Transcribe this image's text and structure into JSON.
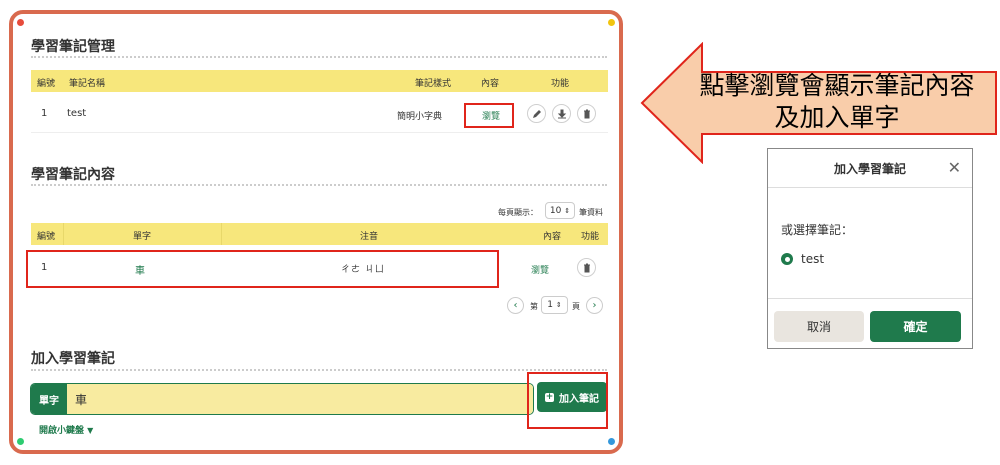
{
  "manage": {
    "title": "學習筆記管理",
    "headers": {
      "no": "編號",
      "name": "筆記名稱",
      "style": "筆記樣式",
      "content": "內容",
      "func": "功能"
    },
    "row": {
      "no": "1",
      "name": "test",
      "style": "簡明小字典",
      "browse": "瀏覽"
    }
  },
  "content": {
    "title": "學習筆記內容",
    "per_page_label": "每頁顯示：",
    "per_page_value": "10",
    "per_page_unit": "筆資料",
    "headers": {
      "no": "編號",
      "word": "單字",
      "zhuyin": "注音",
      "content": "內容",
      "func": "功能"
    },
    "row": {
      "no": "1",
      "word": "車",
      "zhuyin": "ㄔㄜ ㄐㄩ",
      "browse": "瀏覽"
    },
    "pagination": {
      "prefix": "第",
      "page": "1",
      "suffix": "頁",
      "prev": "‹",
      "next": "›"
    }
  },
  "add": {
    "title": "加入學習筆記",
    "input_label": "單字",
    "input_value": "車",
    "button_label": "加入筆記",
    "keyboard_link": "開啟小鍵盤"
  },
  "callout": {
    "line1": "點擊瀏覽會顯示筆記內容",
    "line2": "及加入單字"
  },
  "modal": {
    "title": "加入學習筆記",
    "prompt": "或選擇筆記：",
    "option": "test",
    "cancel": "取消",
    "confirm": "確定"
  },
  "colors": {
    "frame": "#d96a4e",
    "header": "#f7e77c",
    "green": "#1f7a4c",
    "highlight": "#e0251b",
    "arrow": "#f9cdaa"
  }
}
